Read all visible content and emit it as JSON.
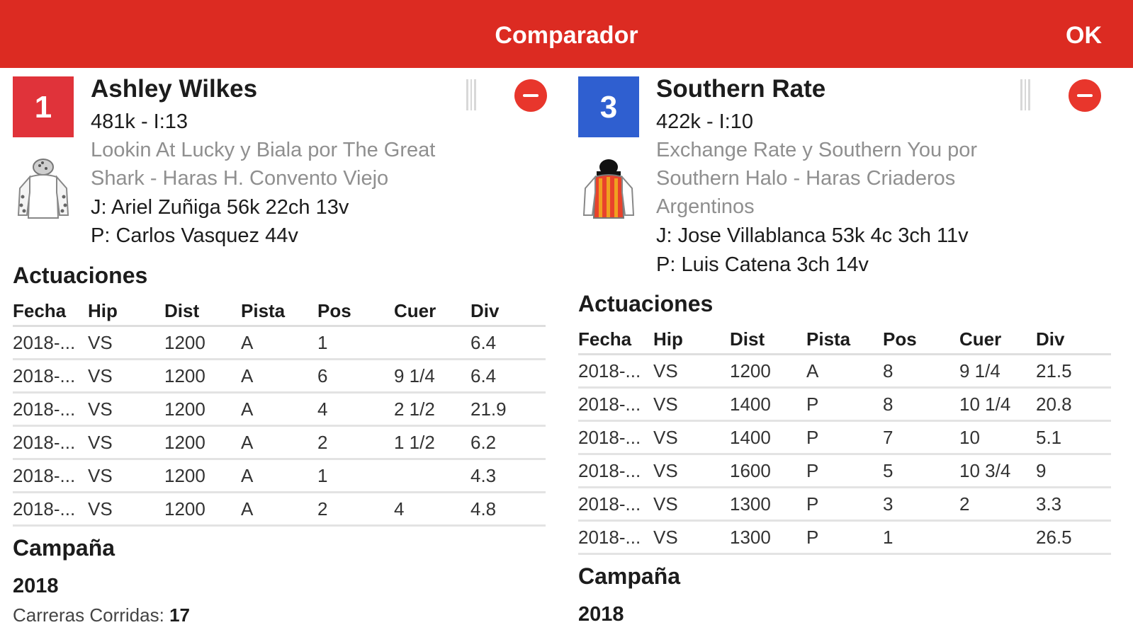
{
  "header": {
    "title": "Comparador",
    "ok_label": "OK"
  },
  "colors": {
    "header_bg": "#dc2b22",
    "badge_1": "#e0333a",
    "badge_3": "#2f5fd0",
    "remove": "#e8362c"
  },
  "columns_labels": [
    "Fecha",
    "Hip",
    "Dist",
    "Pista",
    "Pos",
    "Cuer",
    "Div"
  ],
  "horses": [
    {
      "number": "1",
      "name": "Ashley Wilkes",
      "weight_line": "481k - I:13",
      "pedigree_1": "Lookin At Lucky y Biala por The Great",
      "pedigree_2": "Shark - Haras H. Convento Viejo",
      "pedigree_3": "",
      "jockey": "J: Ariel Zuñiga 56k 22ch 13v",
      "trainer": "P: Carlos Vasquez 44v",
      "silks_icon": "white-silks-grey-sleeves-icon",
      "performances_title": "Actuaciones",
      "rows": [
        [
          "2018-...",
          "VS",
          "1200",
          "A",
          "1",
          "",
          "6.4"
        ],
        [
          "2018-...",
          "VS",
          "1200",
          "A",
          "6",
          "9 1/4",
          "6.4"
        ],
        [
          "2018-...",
          "VS",
          "1200",
          "A",
          "4",
          "2 1/2",
          "21.9"
        ],
        [
          "2018-...",
          "VS",
          "1200",
          "A",
          "2",
          "1 1/2",
          "6.2"
        ],
        [
          "2018-...",
          "VS",
          "1200",
          "A",
          "1",
          "",
          "4.3"
        ],
        [
          "2018-...",
          "VS",
          "1200",
          "A",
          "2",
          "4",
          "4.8"
        ]
      ],
      "campaign_title": "Campaña",
      "campaign_year": "2018",
      "stat_label": "Carreras Corridas:",
      "stat_value": "17"
    },
    {
      "number": "3",
      "name": "Southern Rate",
      "weight_line": "422k - I:10",
      "pedigree_1": "Exchange Rate y Southern You por",
      "pedigree_2": "Southern Halo - Haras Criaderos",
      "pedigree_3": "Argentinos",
      "jockey": "J: Jose Villablanca 53k 4c 3ch 11v",
      "trainer": "P: Luis Catena 3ch 14v",
      "silks_icon": "red-orange-striped-silks-icon",
      "performances_title": "Actuaciones",
      "rows": [
        [
          "2018-...",
          "VS",
          "1200",
          "A",
          "8",
          "9 1/4",
          "21.5"
        ],
        [
          "2018-...",
          "VS",
          "1400",
          "P",
          "8",
          "10 1/4",
          "20.8"
        ],
        [
          "2018-...",
          "VS",
          "1400",
          "P",
          "7",
          "10",
          "5.1"
        ],
        [
          "2018-...",
          "VS",
          "1600",
          "P",
          "5",
          "10 3/4",
          "9"
        ],
        [
          "2018-...",
          "VS",
          "1300",
          "P",
          "3",
          "2",
          "3.3"
        ],
        [
          "2018-...",
          "VS",
          "1300",
          "P",
          "1",
          "",
          "26.5"
        ]
      ],
      "campaign_title": "Campaña",
      "campaign_year": "2018"
    }
  ]
}
